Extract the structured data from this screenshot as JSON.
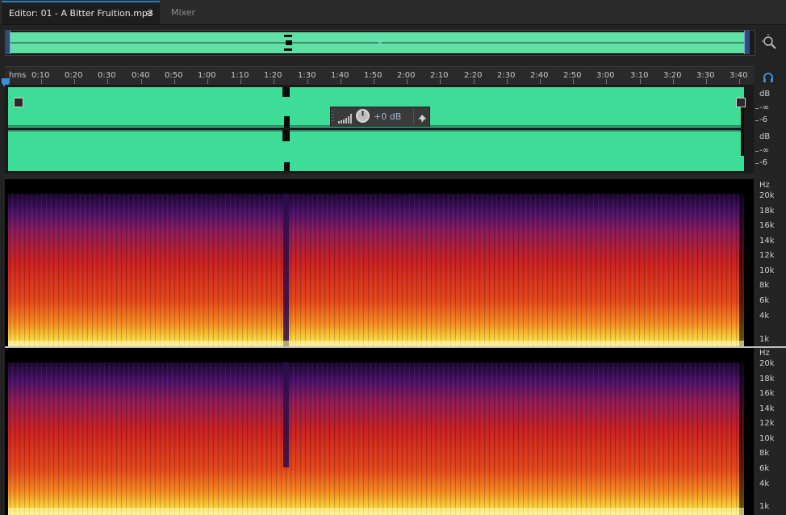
{
  "tabs": {
    "editor_label": "Editor: 01 - A Bitter Fruition.mp3",
    "editor_menu_glyph": "≡",
    "mixer_label": "Mixer"
  },
  "ruler": {
    "unit_label": "hms",
    "ticks": [
      "0:10",
      "0:20",
      "0:30",
      "0:40",
      "0:50",
      "1:00",
      "1:10",
      "1:20",
      "1:30",
      "1:40",
      "1:50",
      "2:00",
      "2:10",
      "2:20",
      "2:30",
      "2:40",
      "2:50",
      "3:00",
      "3:10",
      "3:20",
      "3:30",
      "3:40"
    ]
  },
  "hud": {
    "value": "+0 dB"
  },
  "db_scale": {
    "channel1": [
      "dB",
      "-∞",
      "-6"
    ],
    "channel2": [
      "dB",
      "-∞",
      "-6"
    ]
  },
  "hz_scale": {
    "channel1": [
      "Hz",
      "20k",
      "18k",
      "16k",
      "14k",
      "12k",
      "10k",
      "8k",
      "6k",
      "4k",
      "1k"
    ],
    "channel2": [
      "Hz",
      "20k",
      "18k",
      "16k",
      "14k",
      "12k",
      "10k",
      "8k",
      "6k",
      "4k",
      "1k"
    ]
  },
  "colors": {
    "waveform": "#3ddc97",
    "overview": "#5fe0a5",
    "accent": "#2e7dbd"
  },
  "icons": {
    "zoom": "zoom-selection-icon",
    "monitor": "headphone-icon",
    "pin": "pin-icon",
    "knob": "volume-knob-icon"
  }
}
